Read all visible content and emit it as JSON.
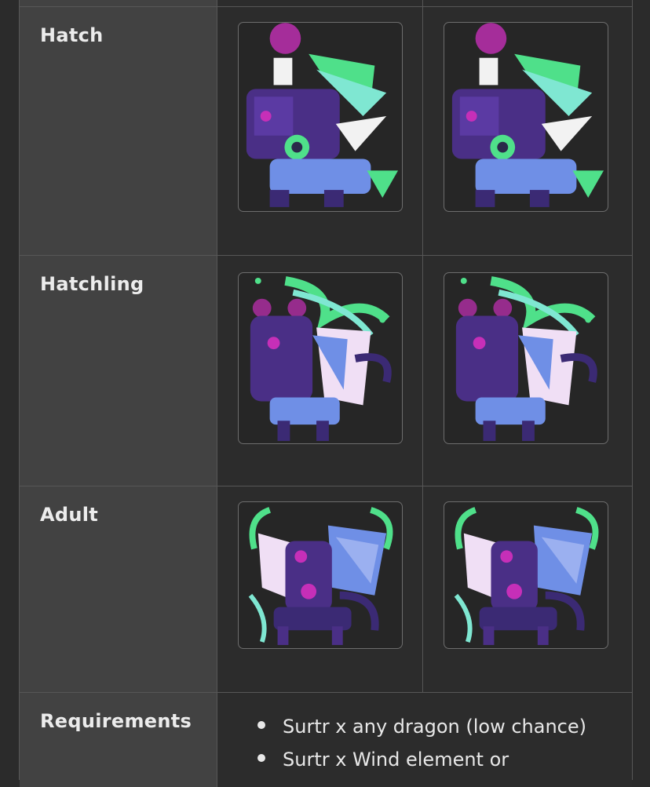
{
  "stages": [
    {
      "label": "Hatch",
      "images": [
        "hatch-sprite",
        "hatch-sprite-alt"
      ]
    },
    {
      "label": "Hatchling",
      "images": [
        "hatchling-sprite",
        "hatchling-sprite-alt"
      ]
    },
    {
      "label": "Adult",
      "images": [
        "adult-sprite",
        "adult-sprite-alt"
      ]
    }
  ],
  "requirements": {
    "label": "Requirements",
    "items": [
      "Surtr x any dragon (low chance)",
      "Surtr x Wind element or"
    ]
  },
  "colors": {
    "page_bg": "#2b2b2b",
    "header_cell_bg": "#424242",
    "border": "#575757",
    "sprite_purple": "#4a2f86",
    "sprite_green": "#4fe08a",
    "sprite_magenta": "#c62fb8",
    "sprite_blue": "#6f8fe6"
  }
}
